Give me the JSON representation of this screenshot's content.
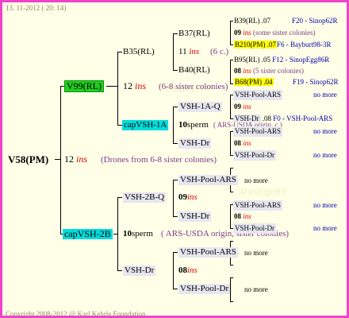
{
  "header": {
    "date": "13. 11-2012 ( 20: 14)"
  },
  "footer": {
    "copyright": "Copyright 2008-2012 @ Karl Kehrle Foundation."
  },
  "watermark": "Pedigree",
  "root": {
    "name": "V58(PM)",
    "count": "12",
    "ins": "ins",
    "note": "(Drones from 6-8 sister colonies)"
  },
  "top": {
    "name": "V99(RL)",
    "count": "12",
    "ins": "ins",
    "note": "(6-8 sister colonies)",
    "b35": {
      "name": "B35(RL)",
      "count": "11",
      "ins": "ins",
      "note": "(6 c.)",
      "b37": {
        "name": "B37(RL)",
        "father": "B39(RL)",
        "father_year": ".07",
        "father_loc": "F20 - Sinop62R",
        "count": "09",
        "ins": "ins",
        "note": "(some sister colonies)",
        "mother": "B210(PM)",
        "mother_year": ".07",
        "mother_loc": "F6 - Bayburt98-3R"
      },
      "b40": {
        "name": "B40(RL)",
        "father": "B95(RL)",
        "father_year": ".05",
        "father_loc": "F12 - SinopEgg86R",
        "count": "08",
        "ins": "ins",
        "note": "(5 sister colonies)",
        "mother": "B68(PM)",
        "mother_year": ".04",
        "mother_loc": "F19 - Sinop62R"
      }
    },
    "cap1a": {
      "name": "capVSH-1A",
      "count": "10",
      "sperm": "sperm",
      "note": "( ARS-USDA origin, c.)",
      "vsh1aq": {
        "name": "VSH-1A-Q",
        "father": "VSH-Pool-ARS",
        "father_more": "no more",
        "count": "09",
        "ins": "ins",
        "mother": "VSH-Dr",
        "mother_year": ".08",
        "mother_loc": "F0 - VSH-Pool-ARS"
      },
      "vshdr": {
        "name": "VSH-Dr",
        "father": "VSH-Pool-ARS",
        "father_more": "no more",
        "count": "08",
        "ins": "ins",
        "mother": "VSH-Pool-Dr",
        "mother_more": "no more"
      }
    }
  },
  "bottom": {
    "name": "capVSH-2B",
    "count": "10",
    "sperm": "sperm",
    "note": "( ARS-USDA origin, sister colonies)",
    "q2b": {
      "name": "VSH-2B-Q",
      "count": "09",
      "ins": "ins",
      "father": "VSH-Pool-ARS",
      "father_more": "no more",
      "mother": "VSH-Dr",
      "gf": "VSH-Pool-ARS",
      "gf_more": "no more",
      "gcount": "08",
      "gins": "ins",
      "gm": "VSH-Pool-Dr",
      "gm_more": "no more"
    },
    "dr": {
      "name": "VSH-Dr",
      "count": "08",
      "ins": "ins",
      "father": "VSH-Pool-ARS",
      "father_more": "no more",
      "mother": "VSH-Pool-Dr",
      "mother_more": "no more"
    }
  }
}
